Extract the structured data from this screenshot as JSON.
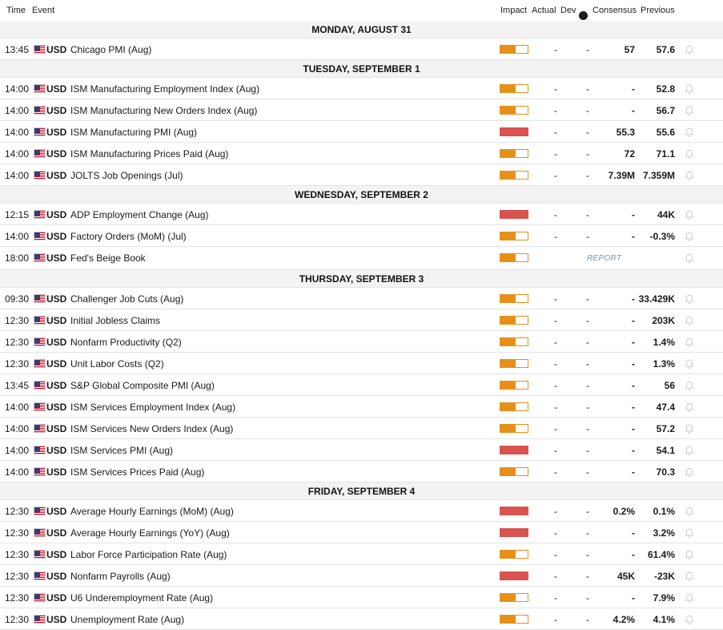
{
  "headers": {
    "time": "Time",
    "event": "Event",
    "impact": "Impact",
    "actual": "Actual",
    "dev": "Dev",
    "consensus": "Consensus",
    "previous": "Previous"
  },
  "colors": {
    "medium_impact": "#e6901a",
    "high_impact": "#d9534f",
    "report_link": "#7a95b0"
  },
  "days": [
    {
      "label": "MONDAY, AUGUST 31",
      "events": [
        {
          "time": "13:45",
          "currency": "USD",
          "event": "Chicago PMI (Aug)",
          "impact": "medium",
          "actual": "-",
          "dev": "-",
          "consensus": "57",
          "previous": "57.6"
        }
      ]
    },
    {
      "label": "TUESDAY, SEPTEMBER 1",
      "events": [
        {
          "time": "14:00",
          "currency": "USD",
          "event": "ISM Manufacturing Employment Index (Aug)",
          "impact": "medium",
          "actual": "-",
          "dev": "-",
          "consensus": "-",
          "previous": "52.8"
        },
        {
          "time": "14:00",
          "currency": "USD",
          "event": "ISM Manufacturing New Orders Index (Aug)",
          "impact": "medium",
          "actual": "-",
          "dev": "-",
          "consensus": "-",
          "previous": "56.7"
        },
        {
          "time": "14:00",
          "currency": "USD",
          "event": "ISM Manufacturing PMI (Aug)",
          "impact": "high",
          "actual": "-",
          "dev": "-",
          "consensus": "55.3",
          "previous": "55.6"
        },
        {
          "time": "14:00",
          "currency": "USD",
          "event": "ISM Manufacturing Prices Paid (Aug)",
          "impact": "medium",
          "actual": "-",
          "dev": "-",
          "consensus": "72",
          "previous": "71.1"
        },
        {
          "time": "14:00",
          "currency": "USD",
          "event": "JOLTS Job Openings (Jul)",
          "impact": "medium",
          "actual": "-",
          "dev": "-",
          "consensus": "7.39M",
          "previous": "7.359M"
        }
      ]
    },
    {
      "label": "WEDNESDAY, SEPTEMBER 2",
      "events": [
        {
          "time": "12:15",
          "currency": "USD",
          "event": "ADP Employment Change (Aug)",
          "impact": "high",
          "actual": "-",
          "dev": "-",
          "consensus": "-",
          "previous": "44K"
        },
        {
          "time": "14:00",
          "currency": "USD",
          "event": "Factory Orders (MoM) (Jul)",
          "impact": "medium",
          "actual": "-",
          "dev": "-",
          "consensus": "-",
          "previous": "-0.3%"
        },
        {
          "time": "18:00",
          "currency": "USD",
          "event": "Fed's Beige Book",
          "impact": "medium",
          "report": "REPORT"
        }
      ]
    },
    {
      "label": "THURSDAY, SEPTEMBER 3",
      "events": [
        {
          "time": "09:30",
          "currency": "USD",
          "event": "Challenger Job Cuts (Aug)",
          "impact": "medium",
          "actual": "-",
          "dev": "-",
          "consensus": "-",
          "previous": "33.429K"
        },
        {
          "time": "12:30",
          "currency": "USD",
          "event": "Initial Jobless Claims",
          "impact": "medium",
          "actual": "-",
          "dev": "-",
          "consensus": "-",
          "previous": "203K"
        },
        {
          "time": "12:30",
          "currency": "USD",
          "event": "Nonfarm Productivity (Q2)",
          "impact": "medium",
          "actual": "-",
          "dev": "-",
          "consensus": "-",
          "previous": "1.4%"
        },
        {
          "time": "12:30",
          "currency": "USD",
          "event": "Unit Labor Costs (Q2)",
          "impact": "medium",
          "actual": "-",
          "dev": "-",
          "consensus": "-",
          "previous": "1.3%"
        },
        {
          "time": "13:45",
          "currency": "USD",
          "event": "S&P Global Composite PMI (Aug)",
          "impact": "medium",
          "actual": "-",
          "dev": "-",
          "consensus": "-",
          "previous": "56"
        },
        {
          "time": "14:00",
          "currency": "USD",
          "event": "ISM Services Employment Index (Aug)",
          "impact": "medium",
          "actual": "-",
          "dev": "-",
          "consensus": "-",
          "previous": "47.4"
        },
        {
          "time": "14:00",
          "currency": "USD",
          "event": "ISM Services New Orders Index (Aug)",
          "impact": "medium",
          "actual": "-",
          "dev": "-",
          "consensus": "-",
          "previous": "57.2"
        },
        {
          "time": "14:00",
          "currency": "USD",
          "event": "ISM Services PMI (Aug)",
          "impact": "high",
          "actual": "-",
          "dev": "-",
          "consensus": "-",
          "previous": "54.1"
        },
        {
          "time": "14:00",
          "currency": "USD",
          "event": "ISM Services Prices Paid (Aug)",
          "impact": "medium",
          "actual": "-",
          "dev": "-",
          "consensus": "-",
          "previous": "70.3"
        }
      ]
    },
    {
      "label": "FRIDAY, SEPTEMBER 4",
      "events": [
        {
          "time": "12:30",
          "currency": "USD",
          "event": "Average Hourly Earnings (MoM) (Aug)",
          "impact": "high",
          "actual": "-",
          "dev": "-",
          "consensus": "0.2%",
          "previous": "0.1%"
        },
        {
          "time": "12:30",
          "currency": "USD",
          "event": "Average Hourly Earnings (YoY) (Aug)",
          "impact": "high",
          "actual": "-",
          "dev": "-",
          "consensus": "-",
          "previous": "3.2%"
        },
        {
          "time": "12:30",
          "currency": "USD",
          "event": "Labor Force Participation Rate (Aug)",
          "impact": "medium",
          "actual": "-",
          "dev": "-",
          "consensus": "-",
          "previous": "61.4%"
        },
        {
          "time": "12:30",
          "currency": "USD",
          "event": "Nonfarm Payrolls (Aug)",
          "impact": "high",
          "actual": "-",
          "dev": "-",
          "consensus": "45K",
          "previous": "-23K"
        },
        {
          "time": "12:30",
          "currency": "USD",
          "event": "U6 Underemployment Rate (Aug)",
          "impact": "medium",
          "actual": "-",
          "dev": "-",
          "consensus": "-",
          "previous": "7.9%"
        },
        {
          "time": "12:30",
          "currency": "USD",
          "event": "Unemployment Rate (Aug)",
          "impact": "medium",
          "actual": "-",
          "dev": "-",
          "consensus": "4.2%",
          "previous": "4.1%"
        }
      ]
    }
  ]
}
